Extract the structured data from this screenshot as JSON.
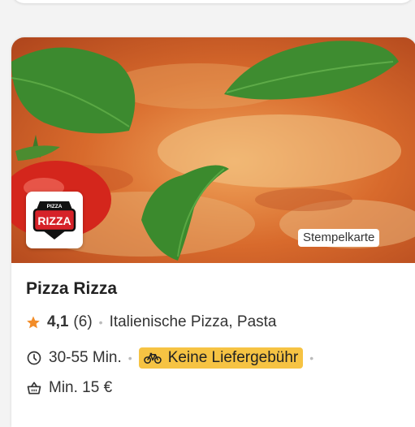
{
  "restaurant": {
    "name": "Pizza Rizza",
    "rating": "4,1",
    "review_count": "(6)",
    "cuisine": "Italienische Pizza, Pasta",
    "delivery_time": "30-55 Min.",
    "delivery_fee": "Keine Liefergebühr",
    "minimum_order": "Min. 15 €",
    "badge": "Stempelkarte",
    "logo": {
      "top": "PIZZA",
      "main": "RIZZA"
    }
  },
  "icons": {
    "rating": "star-icon",
    "time": "clock-icon",
    "delivery": "bicycle-icon",
    "minimum": "basket-icon"
  },
  "colors": {
    "accent_star": "#f28c28",
    "delivery_fee_bg": "#f6c343",
    "logo_red": "#d62229"
  }
}
